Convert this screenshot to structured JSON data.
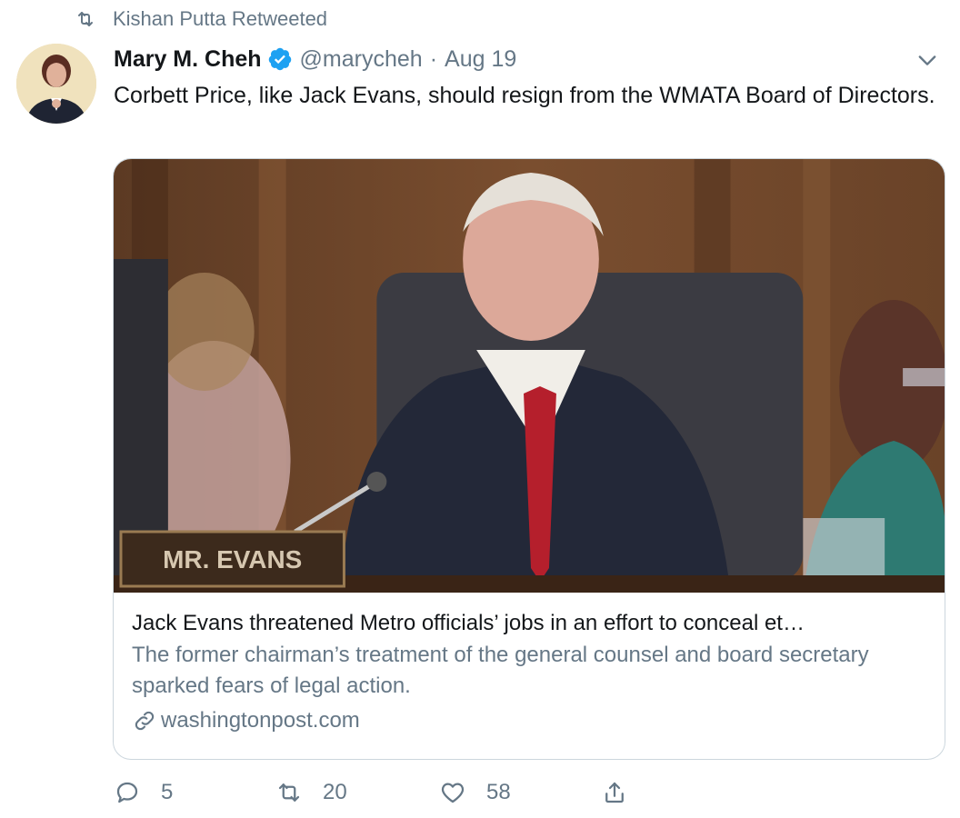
{
  "retweeted_by": "Kishan Putta Retweeted",
  "author": {
    "name": "Mary M. Cheh",
    "handle": "@marycheh",
    "separator": "·",
    "date": "Aug 19"
  },
  "tweet": {
    "text": "Corbett Price, like Jack Evans, should resign from the WMATA Board of Directors."
  },
  "card": {
    "image_nameplate": "MR. EVANS",
    "title": "Jack Evans threatened Metro officials’ jobs in an effort to conceal et…",
    "description": "The former chairman’s treatment of the general counsel and board secretary sparked fears of legal action.",
    "domain": "washingtonpost.com"
  },
  "actions": {
    "replies": "5",
    "retweets": "20",
    "likes": "58"
  },
  "colors": {
    "verified": "#1da1f2",
    "muted": "#657786",
    "border": "#ccd6dd",
    "text": "#14171a"
  },
  "icons": [
    "retweet-icon",
    "verified-badge-icon",
    "caret-down-icon",
    "link-icon",
    "reply-icon",
    "like-icon",
    "share-icon"
  ]
}
